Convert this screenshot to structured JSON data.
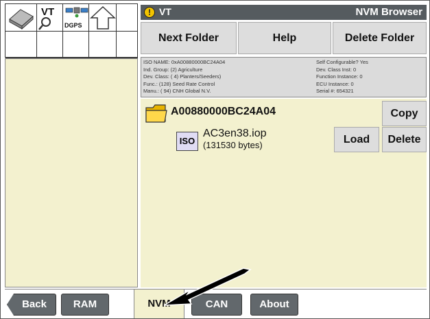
{
  "toolbar": {
    "vt_icon_label": "VT",
    "dgps_label": "DGPS"
  },
  "titlebar": {
    "vt_title": "VT",
    "app_title": "NVM Browser"
  },
  "top_buttons": {
    "next_folder": "Next Folder",
    "help": "Help",
    "delete_folder": "Delete Folder"
  },
  "iso_info": {
    "left": [
      "ISO NAME: 0xA00880000BC24A04",
      "Ind. Group: (2) Agriculture",
      "Dev. Class: ( 4) Planters/Seeders)",
      "Func.: (128) Seed Rate Control",
      "Manu.: ( 94) CNH Global N.V."
    ],
    "right": [
      "Self Configurable? Yes",
      "Dev. Class Inst: 0",
      "Function Instance: 0",
      "ECU Instance: 0",
      "Serial #: 654321"
    ]
  },
  "folder": {
    "name": "A00880000BC24A04",
    "copy_label": "Copy"
  },
  "file": {
    "iso_badge": "ISO",
    "name": "AC3en38.iop",
    "size": "(131530 bytes)",
    "load_label": "Load",
    "delete_label": "Delete"
  },
  "bottom_tabs": {
    "back": "Back",
    "ram": "RAM",
    "nvm": "NVM",
    "can": "CAN",
    "about": "About"
  },
  "colors": {
    "panel_bg": "#f3f1cf",
    "titlebar_bg": "#555b5f",
    "button_bg": "#dddddd",
    "tab_bg": "#62686c",
    "vt_icon": "#f2c400"
  }
}
